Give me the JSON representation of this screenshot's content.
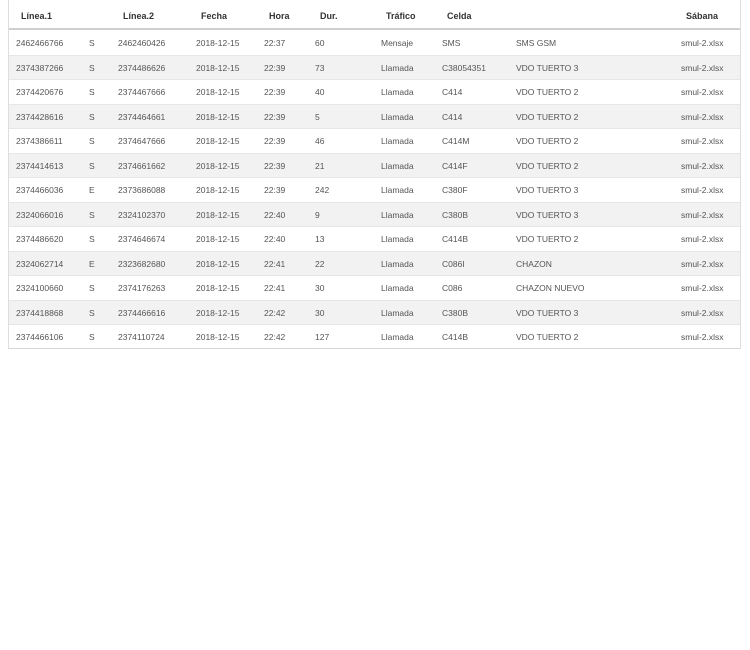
{
  "table": {
    "headers": {
      "linea1": "Línea.1",
      "linea2": "Línea.2",
      "fecha": "Fecha",
      "hora": "Hora",
      "dur": "Dur.",
      "trafico": "Tráfico",
      "celda": "Celda",
      "sabana": "Sábana"
    },
    "rows": [
      {
        "linea1": "2462466766",
        "dir": "S",
        "linea2": "2462460426",
        "fecha": "2018-12-15",
        "hora": "22:37",
        "dur": "60",
        "trafico": "Mensaje",
        "celda": "SMS",
        "desc": "SMS GSM",
        "sabana": "smul-2.xlsx"
      },
      {
        "linea1": "2374387266",
        "dir": "S",
        "linea2": "2374486626",
        "fecha": "2018-12-15",
        "hora": "22:39",
        "dur": "73",
        "trafico": "Llamada",
        "celda": "C38054351",
        "desc": "VDO TUERTO 3",
        "sabana": "smul-2.xlsx"
      },
      {
        "linea1": "2374420676",
        "dir": "S",
        "linea2": "2374467666",
        "fecha": "2018-12-15",
        "hora": "22:39",
        "dur": "40",
        "trafico": "Llamada",
        "celda": "C414",
        "desc": "VDO TUERTO 2",
        "sabana": "smul-2.xlsx"
      },
      {
        "linea1": "2374428616",
        "dir": "S",
        "linea2": "2374464661",
        "fecha": "2018-12-15",
        "hora": "22:39",
        "dur": "5",
        "trafico": "Llamada",
        "celda": "C414",
        "desc": "VDO TUERTO 2",
        "sabana": "smul-2.xlsx"
      },
      {
        "linea1": "2374386611",
        "dir": "S",
        "linea2": "2374647666",
        "fecha": "2018-12-15",
        "hora": "22:39",
        "dur": "46",
        "trafico": "Llamada",
        "celda": "C414M",
        "desc": "VDO TUERTO 2",
        "sabana": "smul-2.xlsx"
      },
      {
        "linea1": "2374414613",
        "dir": "S",
        "linea2": "2374661662",
        "fecha": "2018-12-15",
        "hora": "22:39",
        "dur": "21",
        "trafico": "Llamada",
        "celda": "C414F",
        "desc": "VDO TUERTO 2",
        "sabana": "smul-2.xlsx"
      },
      {
        "linea1": "2374466036",
        "dir": "E",
        "linea2": "2373686088",
        "fecha": "2018-12-15",
        "hora": "22:39",
        "dur": "242",
        "trafico": "Llamada",
        "celda": "C380F",
        "desc": "VDO TUERTO 3",
        "sabana": "smul-2.xlsx"
      },
      {
        "linea1": "2324066016",
        "dir": "S",
        "linea2": "2324102370",
        "fecha": "2018-12-15",
        "hora": "22:40",
        "dur": "9",
        "trafico": "Llamada",
        "celda": "C380B",
        "desc": "VDO TUERTO 3",
        "sabana": "smul-2.xlsx"
      },
      {
        "linea1": "2374486620",
        "dir": "S",
        "linea2": "2374646674",
        "fecha": "2018-12-15",
        "hora": "22:40",
        "dur": "13",
        "trafico": "Llamada",
        "celda": "C414B",
        "desc": "VDO TUERTO 2",
        "sabana": "smul-2.xlsx"
      },
      {
        "linea1": "2324062714",
        "dir": "E",
        "linea2": "2323682680",
        "fecha": "2018-12-15",
        "hora": "22:41",
        "dur": "22",
        "trafico": "Llamada",
        "celda": "C086I",
        "desc": "CHAZON",
        "sabana": "smul-2.xlsx"
      },
      {
        "linea1": "2324100660",
        "dir": "S",
        "linea2": "2374176263",
        "fecha": "2018-12-15",
        "hora": "22:41",
        "dur": "30",
        "trafico": "Llamada",
        "celda": "C086",
        "desc": "CHAZON NUEVO",
        "sabana": "smul-2.xlsx"
      },
      {
        "linea1": "2374418868",
        "dir": "S",
        "linea2": "2374466616",
        "fecha": "2018-12-15",
        "hora": "22:42",
        "dur": "30",
        "trafico": "Llamada",
        "celda": "C380B",
        "desc": "VDO TUERTO 3",
        "sabana": "smul-2.xlsx"
      },
      {
        "linea1": "2374466106",
        "dir": "S",
        "linea2": "2374110724",
        "fecha": "2018-12-15",
        "hora": "22:42",
        "dur": "127",
        "trafico": "Llamada",
        "celda": "C414B",
        "desc": "VDO TUERTO 2",
        "sabana": "smul-2.xlsx"
      }
    ]
  }
}
